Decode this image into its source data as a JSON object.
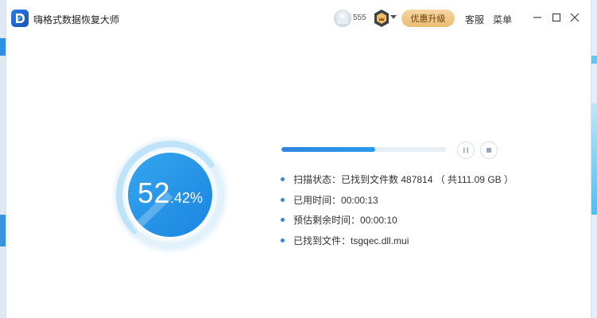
{
  "app": {
    "title": "嗨格式数据恢复大师"
  },
  "header": {
    "user_id": "555",
    "upgrade_label": "优惠升级",
    "support_label": "客服",
    "menu_label": "菜单"
  },
  "scan": {
    "percent_int": "52",
    "percent_dec": ".42%",
    "progress": 0.5242,
    "bar_progress_percent": 57
  },
  "info": {
    "status_label": "扫描状态：",
    "status_value": "已找到文件数 487814 （ 共111.09 GB ）",
    "elapsed_label": "已用时间：",
    "elapsed_value": "00:00:13",
    "remaining_label": "预估剩余时间：",
    "remaining_value": "00:00:10",
    "found_label": "已找到文件：",
    "found_value": "tsgqec.dll.mui"
  },
  "colors": {
    "accent": "#2b8be6",
    "ring_start": "#3aa9f0",
    "ring_end": "#1e8de6",
    "upgrade_bg": "#ebbd72"
  },
  "icons": {
    "logo": "D-logo-icon",
    "vip": "vip-badge-icon",
    "pause": "pause-icon",
    "stop": "stop-icon",
    "minimize": "minimize-icon",
    "maximize": "maximize-icon",
    "close": "close-icon"
  }
}
